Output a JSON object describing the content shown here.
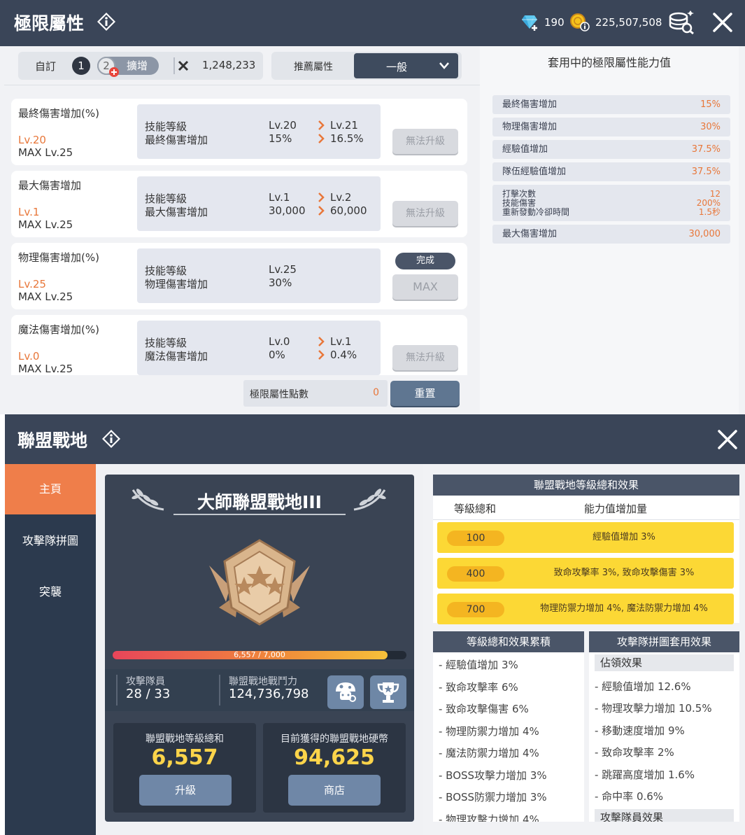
{
  "top": {
    "title": "極限屬性",
    "currency": {
      "gems": "190",
      "meso": "225,507,508"
    },
    "tabs": {
      "custom_label": "自訂",
      "preset1": "1",
      "preset2": "2",
      "expand_label": "擴增",
      "power_value": "1,248,233"
    },
    "recommend": {
      "label": "推薦屬性",
      "selected": "一般"
    },
    "stats": [
      {
        "name": "最終傷害增加(%)",
        "level": "Lv.20",
        "max": "MAX Lv.25",
        "row1_label": "技能等級",
        "row2_label": "最終傷害增加",
        "cur_lv": "Lv.20",
        "cur_val": "15%",
        "next_lv": "Lv.21",
        "next_val": "16.5%",
        "button": "無法升級"
      },
      {
        "name": "最大傷害增加",
        "level": "Lv.1",
        "max": "MAX Lv.25",
        "row1_label": "技能等級",
        "row2_label": "最大傷害增加",
        "cur_lv": "Lv.1",
        "cur_val": "30,000",
        "next_lv": "Lv.2",
        "next_val": "60,000",
        "button": "無法升級"
      },
      {
        "name": "物理傷害增加(%)",
        "level": "Lv.25",
        "max": "MAX Lv.25",
        "row1_label": "技能等級",
        "row2_label": "物理傷害增加",
        "cur_lv": "Lv.25",
        "cur_val": "30%",
        "done_label": "完成",
        "button": "MAX"
      },
      {
        "name": "魔法傷害增加(%)",
        "level": "Lv.0",
        "max": "MAX Lv.25",
        "row1_label": "技能等級",
        "row2_label": "魔法傷害增加",
        "cur_lv": "Lv.0",
        "cur_val": "0%",
        "next_lv": "Lv.1",
        "next_val": "0.4%",
        "button": "無法升級"
      }
    ],
    "points": {
      "label": "極限屬性點數",
      "value": "0",
      "reset_label": "重置"
    },
    "applied": {
      "title": "套用中的極限屬性能力值",
      "rows": [
        {
          "label": "最終傷害增加",
          "value": "15%"
        },
        {
          "label": "物理傷害增加",
          "value": "30%"
        },
        {
          "label": "經驗值增加",
          "value": "37.5%"
        },
        {
          "label": "隊伍經驗值增加",
          "value": "37.5%"
        }
      ],
      "multi": {
        "labels": [
          "打擊次數",
          "技能傷害",
          "重新發動冷卻時間"
        ],
        "values": [
          "12",
          "200%",
          "1.5秒"
        ]
      },
      "last": {
        "label": "最大傷害增加",
        "value": "30,000"
      }
    }
  },
  "bottom": {
    "title": "聯盟戰地",
    "side": [
      "主頁",
      "攻擊隊拼圖",
      "突襲"
    ],
    "rank_title": "大師聯盟戰地III",
    "progress": {
      "text": "6,557 / 7,000",
      "value": 6557,
      "max": 7000
    },
    "members": {
      "label": "攻擊隊員",
      "value": "28 / 33"
    },
    "power": {
      "label": "聯盟戰地戰鬥力",
      "value": "124,736,798"
    },
    "level_total": {
      "label": "聯盟戰地等級總和",
      "value": "6,557",
      "button": "升級"
    },
    "coins": {
      "label": "目前獲得的聯盟戰地硬幣",
      "value": "94,625",
      "button": "商店"
    },
    "effects": {
      "title": "聯盟戰地等級總和效果",
      "col1": "等級總和",
      "col2": "能力值增加量",
      "rows": [
        {
          "level": "100",
          "effect": "經驗值增加 3%"
        },
        {
          "level": "400",
          "effect": "致命攻擊率 3%, 致命攻擊傷害 3%"
        },
        {
          "level": "700",
          "effect": "物理防禦力增加 4%, 魔法防禦力增加 4%"
        }
      ]
    },
    "cumulative": {
      "title": "等級總和效果累積",
      "items": [
        "- 經驗值增加 3%",
        "- 致命攻擊率 6%",
        "- 致命攻擊傷害 6%",
        "- 物理防禦力增加 4%",
        "- 魔法防禦力增加 4%",
        "- BOSS攻擊力增加 3%",
        "- BOSS防禦力增加 3%",
        "- 物理攻擊力增加 4%"
      ]
    },
    "puzzle": {
      "title": "攻擊隊拼圖套用效果",
      "occupy_label": "佔領效果",
      "items": [
        "- 經驗值增加 12.6%",
        "- 物理攻擊力增加 10.5%",
        "- 移動速度增加 9%",
        "- 致命攻擊率 2%",
        "- 跳躍高度增加 1.6%",
        "- 命中率 0.6%"
      ],
      "member_label": "攻擊隊員效果"
    }
  }
}
